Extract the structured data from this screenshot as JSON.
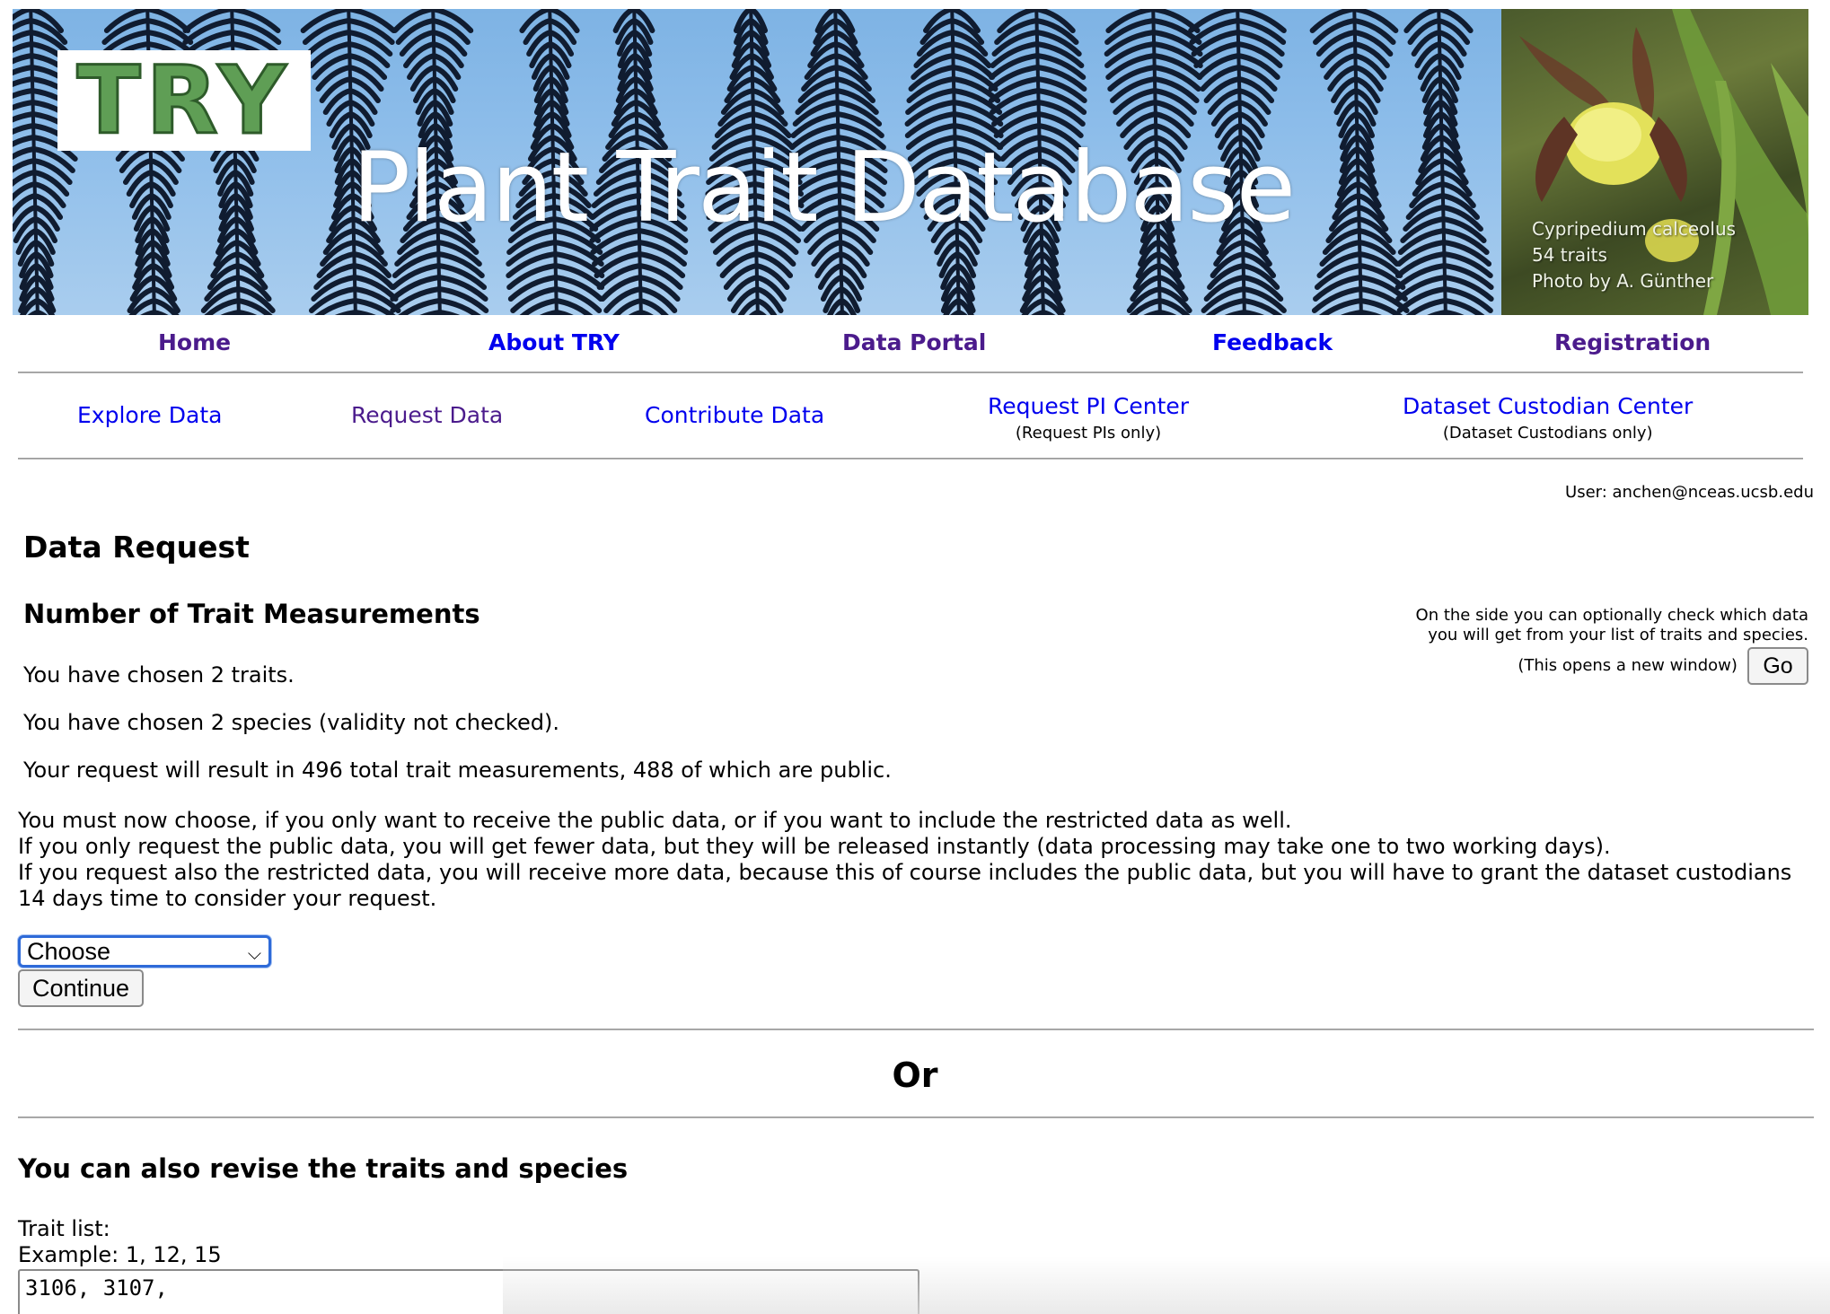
{
  "banner": {
    "logo_text": "TRY",
    "title": "Plant Trait Database",
    "photo_caption": {
      "species": "Cypripedium calceolus",
      "traits": "54 traits",
      "credit": "Photo by A. Günther"
    }
  },
  "main_nav": [
    {
      "label": "Home"
    },
    {
      "label": "About TRY"
    },
    {
      "label": "Data Portal"
    },
    {
      "label": "Feedback"
    },
    {
      "label": "Registration"
    }
  ],
  "sub_nav": [
    {
      "label": "Explore Data",
      "note": ""
    },
    {
      "label": "Request Data",
      "note": ""
    },
    {
      "label": "Contribute Data",
      "note": ""
    },
    {
      "label": "Request PI Center",
      "note": "(Request PIs only)"
    },
    {
      "label": "Dataset Custodian Center",
      "note": "(Dataset Custodians only)"
    }
  ],
  "user": {
    "text": "User: anchen@nceas.ucsb.edu"
  },
  "page": {
    "title": "Data Request",
    "measurements_title": "Number of Trait Measurements",
    "side_box": {
      "line1": "On the side you can optionally check which data",
      "line2": "you will get from your list of traits and species.",
      "note": "(This opens a new window)",
      "go_label": "Go"
    },
    "traits_chosen": "You have chosen 2 traits.",
    "species_chosen": "You have chosen 2 species (validity not checked).",
    "result_summary": "Your request will result in 496 total trait measurements, 488 of which are public.",
    "choice_lines": [
      "You must now choose, if you only want to receive the public data, or if you want to include the restricted data as well.",
      "If you only request the public data, you will get fewer data, but they will be released instantly (data processing may take one to two working days).",
      "If you request also the restricted data, you will receive more data, because this of course includes the public data, but you will have to grant the dataset custodians",
      "14 days time to consider your request."
    ],
    "select_value": "Choose",
    "continue_label": "Continue",
    "or_label": "Or",
    "revise_title": "You can also revise the traits and species",
    "trait_list_label": "Trait list:",
    "trait_example": "Example: 1, 12, 15",
    "trait_value": "3106, 3107,"
  },
  "colors": {
    "nav_visited": "#4b1b8c",
    "nav_link": "#0000ee",
    "focus_ring": "#2e6ad8",
    "logo_green": "#5f9e55"
  }
}
